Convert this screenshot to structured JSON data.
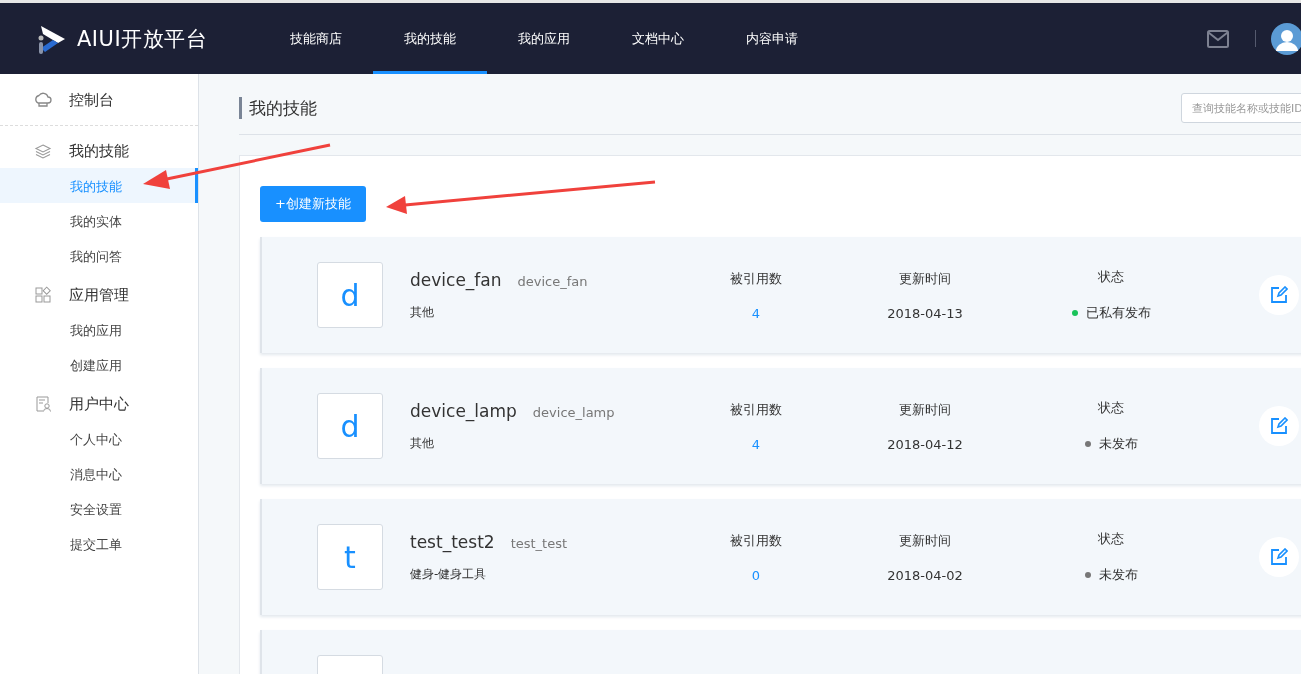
{
  "header": {
    "logo_text": "AIUI开放平台",
    "nav": [
      {
        "label": "技能商店",
        "selected": false
      },
      {
        "label": "我的技能",
        "selected": true
      },
      {
        "label": "我的应用",
        "selected": false
      },
      {
        "label": "文档中心",
        "selected": false
      },
      {
        "label": "内容申请",
        "selected": false
      }
    ]
  },
  "sidebar": {
    "items": [
      {
        "kind": "link",
        "label": "控制台"
      },
      {
        "kind": "group",
        "label": "我的技能",
        "children": [
          {
            "label": "我的技能",
            "selected": true
          },
          {
            "label": "我的实体",
            "selected": false
          },
          {
            "label": "我的问答",
            "selected": false
          }
        ]
      },
      {
        "kind": "group",
        "label": "应用管理",
        "children": [
          {
            "label": "我的应用",
            "selected": false
          },
          {
            "label": "创建应用",
            "selected": false
          }
        ]
      },
      {
        "kind": "group",
        "label": "用户中心",
        "children": [
          {
            "label": "个人中心",
            "selected": false
          },
          {
            "label": "消息中心",
            "selected": false
          },
          {
            "label": "安全设置",
            "selected": false
          },
          {
            "label": "提交工单",
            "selected": false
          }
        ]
      }
    ]
  },
  "page": {
    "title": "我的技能",
    "search": {
      "placeholder": "查询技能名称或技能ID"
    },
    "create_button": "+创建新技能"
  },
  "skills": [
    {
      "letter": "d",
      "name": "device_fan",
      "id": "device_fan",
      "category": "其他",
      "columns": [
        {
          "label": "被引用数",
          "value": "4"
        },
        {
          "label": "更新时间",
          "value": "2018-04-13"
        },
        {
          "label": "状态",
          "value": "已私有发布",
          "color": "#19c35a"
        }
      ]
    },
    {
      "letter": "d",
      "name": "device_lamp",
      "id": "device_lamp",
      "category": "其他",
      "columns": [
        {
          "label": "被引用数",
          "value": "4"
        },
        {
          "label": "更新时间",
          "value": "2018-04-12"
        },
        {
          "label": "状态",
          "value": "未发布",
          "color": "#777777"
        }
      ]
    },
    {
      "letter": "t",
      "name": "test_test2",
      "id": "test_test",
      "category": "健身-健身工具",
      "columns": [
        {
          "label": "被引用数",
          "value": "0"
        },
        {
          "label": "更新时间",
          "value": "2018-04-02"
        },
        {
          "label": "状态",
          "value": "未发布",
          "color": "#777777"
        }
      ]
    },
    {
      "kind": "cut_off"
    }
  ]
}
